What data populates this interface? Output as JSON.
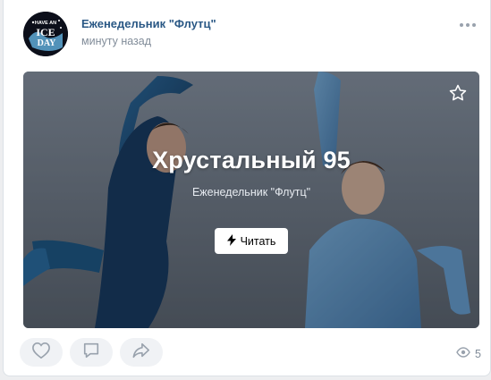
{
  "post": {
    "author": "Еженедельник \"Флутц\"",
    "time": "минуту назад",
    "avatar_text": [
      "HAVE AN",
      "ICE",
      "DAY"
    ]
  },
  "card": {
    "title": "Хрустальный 95",
    "subtitle": "Еженедельник \"Флутц\"",
    "read_label": "Читать"
  },
  "footer": {
    "views": "5"
  },
  "icons": [
    "more-icon",
    "star-icon",
    "lightning-icon",
    "like-icon",
    "comment-icon",
    "share-icon",
    "eye-icon"
  ],
  "colors": {
    "author_link": "#2a5885",
    "muted": "#818c99",
    "action_bg": "#f0f2f5"
  }
}
